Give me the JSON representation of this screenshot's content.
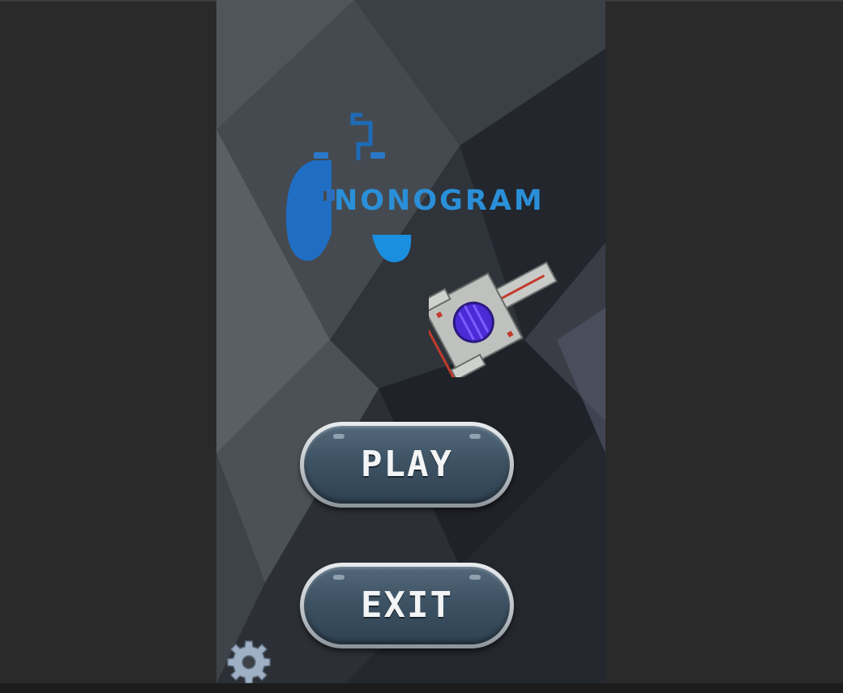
{
  "game": {
    "logo_text": "NONOGRAM",
    "menu": {
      "play_label": "PLAY",
      "exit_label": "EXIT"
    },
    "icons": {
      "logo": "gamepad-logo-icon",
      "ship": "spaceship-icon",
      "settings": "gear-icon"
    },
    "colors": {
      "logo_blue": "#2a8fd8",
      "button_face": "#3d5263",
      "button_rim": "#c8cdd2",
      "background_dark": "#2a2a2a"
    }
  }
}
